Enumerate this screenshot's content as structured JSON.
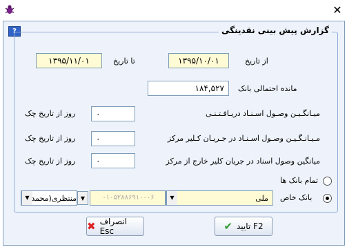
{
  "window": {
    "close_glyph": "✕"
  },
  "group_title": "گزارش پیش بینی نقدینگی",
  "from_date": {
    "label": "از تاریخ",
    "value": "۱۳۹۵/۱۰/۰۱"
  },
  "to_date": {
    "label": "تا تاریخ",
    "value": "۱۳۹۵/۱۱/۰۱"
  },
  "bank_balance": {
    "label": "مانده احتمالی بانک",
    "value": "۱۸۴,۵۲۷"
  },
  "rows": [
    {
      "label": "میـانگـیـن وصـول اسـنـاد دریـافـتـنـی",
      "value": "۰",
      "suffix": "روز از تاریخ چک"
    },
    {
      "label": "مـیـانـگـیـن وصـول اسـنـاد در جـریـان کـلیر مرکز",
      "value": "۰",
      "suffix": "روز از تاریخ چک"
    },
    {
      "label": "میانگین وصول اسناد در جریان کلیر خارج از مرکز",
      "value": "۰",
      "suffix": "روز از تاریخ چک"
    }
  ],
  "radio_all_banks": {
    "label": "تمام بانک ها",
    "selected": false
  },
  "radio_specific_bank": {
    "label": "بانک خاص",
    "selected": true
  },
  "bank_name": "ملی",
  "account_number": "۰۱۰۵۲۸۸۶۹۱۰۰۰۶",
  "account_owner": "منتظری(محمد",
  "buttons": {
    "confirm": "تایید F2",
    "cancel": "انصراف Esc"
  },
  "colors": {
    "field_bg": "#fffbd4",
    "panel_bg": "#eef3fb",
    "accent": "#2f63c8"
  }
}
